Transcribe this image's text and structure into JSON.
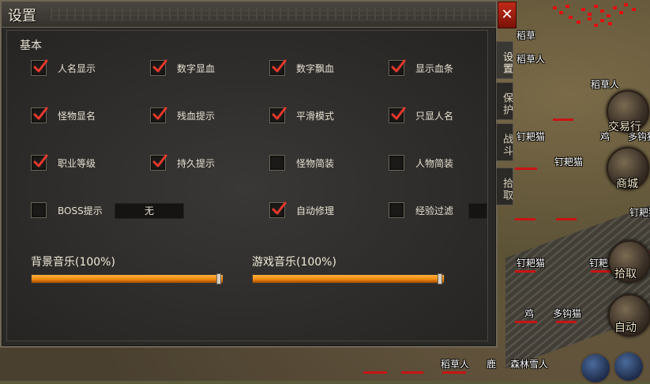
{
  "panel": {
    "title": "设置",
    "close_glyph": "✕",
    "section_basic": "基本",
    "options": [
      {
        "label": "人名显示",
        "checked": true
      },
      {
        "label": "数字显血",
        "checked": true
      },
      {
        "label": "数字飘血",
        "checked": true
      },
      {
        "label": "显示血条",
        "checked": true
      },
      {
        "label": "怪物显名",
        "checked": true
      },
      {
        "label": "残血提示",
        "checked": true
      },
      {
        "label": "平滑模式",
        "checked": true
      },
      {
        "label": "只显人名",
        "checked": true
      },
      {
        "label": "职业等级",
        "checked": true
      },
      {
        "label": "持久提示",
        "checked": true
      },
      {
        "label": "怪物简装",
        "checked": false
      },
      {
        "label": "人物简装",
        "checked": false
      },
      {
        "label": "BOSS提示",
        "checked": false,
        "value": "无"
      },
      {
        "label": "自动修理",
        "checked": true
      },
      {
        "label": "经验过滤",
        "checked": false,
        "value": ""
      }
    ],
    "sliders": [
      {
        "label": "背景音乐(100%)",
        "value": 1.0
      },
      {
        "label": "游戏音乐(100%)",
        "value": 1.0
      }
    ]
  },
  "tabs": [
    {
      "label": "设置",
      "active": true
    },
    {
      "label": "保护",
      "active": false
    },
    {
      "label": "战斗",
      "active": false
    },
    {
      "label": "拾取",
      "active": false
    }
  ],
  "world": {
    "npc_labels": [
      "稻草",
      "稻草人",
      "稻草人",
      "钉耙猫",
      "钉耙猫",
      "鸡",
      "多钩猫",
      "钉耙猫",
      "钉耙猫",
      "钉耙猫",
      "鸡",
      "多钩猫",
      "稻草人",
      "鹿",
      "森林雪人"
    ],
    "buttons": {
      "trade": "交易行",
      "shop": "商城",
      "pickup": "拾取",
      "auto": "自动"
    }
  },
  "colors": {
    "checkmark": "#e8382c",
    "slider_fill": "#f08a10",
    "close_button": "#b02414"
  }
}
